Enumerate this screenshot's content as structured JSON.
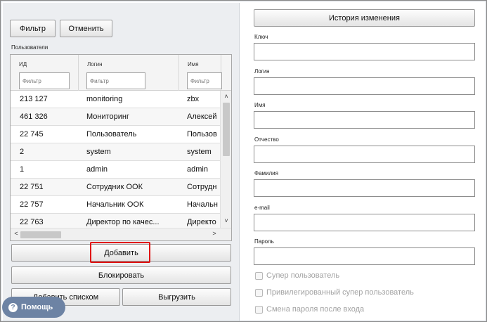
{
  "toolbar": {
    "filter_label": "Фильтр",
    "cancel_label": "Отменить"
  },
  "users": {
    "section_label": "Пользователи",
    "columns": [
      {
        "title": "ИД",
        "filter_placeholder": "Фильтр"
      },
      {
        "title": "Логин",
        "filter_placeholder": "Фильтр"
      },
      {
        "title": "Имя",
        "filter_placeholder": "Фильтр"
      }
    ],
    "rows": [
      {
        "id": "213 127",
        "login": "monitoring",
        "name": "zbx"
      },
      {
        "id": "461 326",
        "login": "Мониторинг",
        "name": "Алексей"
      },
      {
        "id": "22 745",
        "login": "Пользователь",
        "name": "Пользов"
      },
      {
        "id": "2",
        "login": "system",
        "name": "system"
      },
      {
        "id": "1",
        "login": "admin",
        "name": "admin"
      },
      {
        "id": "22 751",
        "login": "Сотрудник ООК",
        "name": "Сотрудн"
      },
      {
        "id": "22 757",
        "login": "Начальник ООК",
        "name": "Начальн"
      },
      {
        "id": "22 763",
        "login": "Директор по качес...",
        "name": "Директо"
      }
    ]
  },
  "actions": {
    "add_label": "Добавить",
    "block_label": "Блокировать",
    "add_list_label": "Добавить списком",
    "export_label": "Выгрузить"
  },
  "help": {
    "label": "Помощь",
    "icon": "question-icon"
  },
  "form": {
    "history_label": "История изменения",
    "fields": [
      {
        "label": "Ключ",
        "value": ""
      },
      {
        "label": "Логин",
        "value": ""
      },
      {
        "label": "Имя",
        "value": ""
      },
      {
        "label": "Отчество",
        "value": ""
      },
      {
        "label": "Фамилия",
        "value": ""
      },
      {
        "label": "e-mail",
        "value": ""
      },
      {
        "label": "Пароль",
        "value": ""
      }
    ],
    "checkboxes": [
      {
        "label": "Супер пользователь",
        "checked": false
      },
      {
        "label": "Привилегированный супер пользователь",
        "checked": false
      },
      {
        "label": "Смена пароля после входа",
        "checked": false
      }
    ]
  },
  "colors": {
    "panel_bg": "#eceef1",
    "help_bg": "#6d83a4",
    "highlight": "#e01010"
  }
}
